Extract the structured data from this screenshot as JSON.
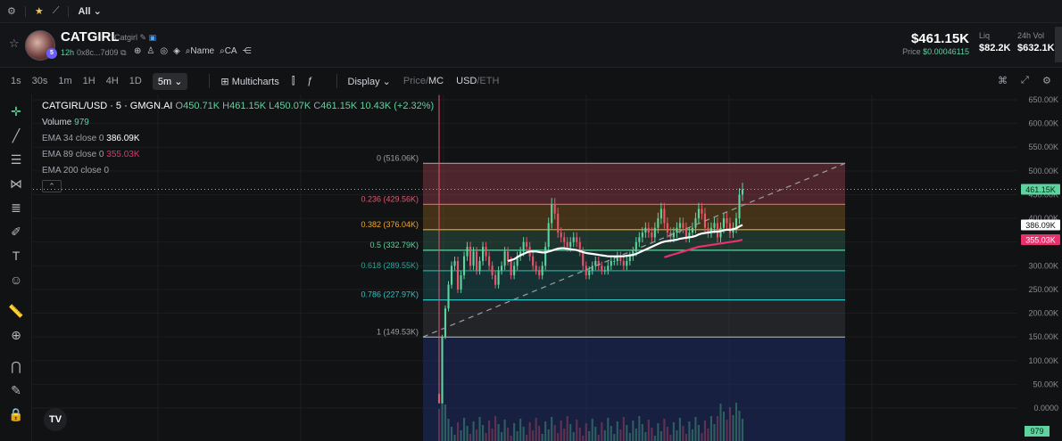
{
  "topbar": {
    "filter_label": "All"
  },
  "token": {
    "name": "CATGIRL",
    "alias": "Catgirl",
    "age": "12h",
    "address": "0x8c...7d09",
    "avatar_badge": "5",
    "links": [
      "Name",
      "CA"
    ],
    "price_usd": "$461.15K",
    "price_label": "Price",
    "price_native": "$0.00046115",
    "liq_label": "Liq",
    "liq_value": "$82.2K",
    "vol_label": "24h Vol",
    "vol_value": "$632.1K"
  },
  "toolbar": {
    "timeframes": [
      "1s",
      "30s",
      "1m",
      "1H",
      "4H",
      "1D"
    ],
    "active_timeframe": "5m",
    "multicharts": "Multicharts",
    "display": "Display",
    "price": "Price",
    "mc": "MC",
    "usd": "USD",
    "eth": "ETH"
  },
  "legend": {
    "symbol": "CATGIRL/USD · 5 · GMGN.AI",
    "o": "450.71K",
    "h": "461.15K",
    "l": "450.07K",
    "c": "461.15K",
    "chg": "10.43K (+2.32%)",
    "volume_label": "Volume",
    "volume_value": "979",
    "ema34_label": "EMA 34 close 0",
    "ema34_value": "386.09K",
    "ema89_label": "EMA 89 close 0",
    "ema89_value": "355.03K",
    "ema200_label": "EMA 200 close 0"
  },
  "colors": {
    "up": "#5dd39e",
    "down": "#e8566c",
    "ema34": "#ffffff",
    "ema89": "#e8306a",
    "bg": "#111214"
  },
  "chart_data": {
    "type": "candlestick",
    "y_axis_ticks": [
      "650.00K",
      "600.00K",
      "550.00K",
      "500.00K",
      "450.00K",
      "400.00K",
      "350.00K",
      "300.00K",
      "250.00K",
      "200.00K",
      "150.00K",
      "100.00K",
      "50.00K",
      "0.0000"
    ],
    "ylim": [
      0,
      650000
    ],
    "fib_levels": [
      {
        "ratio": "0",
        "value": "516.06K",
        "v": 516060,
        "color": "#9aa0a6"
      },
      {
        "ratio": "0.236",
        "value": "429.56K",
        "v": 429560,
        "color": "#e8566c"
      },
      {
        "ratio": "0.382",
        "value": "376.04K",
        "v": 376040,
        "color": "#f5a623"
      },
      {
        "ratio": "0.5",
        "value": "332.79K",
        "v": 332790,
        "color": "#5dd39e"
      },
      {
        "ratio": "0.618",
        "value": "289.55K",
        "v": 289550,
        "color": "#26a69a"
      },
      {
        "ratio": "0.786",
        "value": "227.97K",
        "v": 227970,
        "color": "#2ec4c4"
      },
      {
        "ratio": "1",
        "value": "149.53K",
        "v": 149530,
        "color": "#9aa0a6"
      }
    ],
    "price_tags": [
      {
        "label": "461.15K",
        "v": 461150,
        "bg": "#5dd39e",
        "fg": "#0b2a1c"
      },
      {
        "label": "386.09K",
        "v": 386090,
        "bg": "#ffffff",
        "fg": "#111"
      },
      {
        "label": "355.03K",
        "v": 355030,
        "bg": "#e8306a",
        "fg": "#fff"
      }
    ],
    "volume_tag": "979",
    "closes": [
      10000,
      150000,
      210000,
      260000,
      300000,
      310000,
      250000,
      280000,
      320000,
      340000,
      300000,
      330000,
      290000,
      310000,
      340000,
      320000,
      300000,
      280000,
      260000,
      290000,
      300000,
      330000,
      310000,
      280000,
      300000,
      320000,
      330000,
      350000,
      340000,
      320000,
      300000,
      290000,
      280000,
      300000,
      340000,
      390000,
      430000,
      410000,
      370000,
      360000,
      350000,
      340000,
      350000,
      360000,
      350000,
      330000,
      300000,
      280000,
      290000,
      300000,
      310000,
      300000,
      290000,
      290000,
      300000,
      310000,
      310000,
      320000,
      310000,
      300000,
      310000,
      320000,
      330000,
      350000,
      360000,
      370000,
      380000,
      370000,
      360000,
      380000,
      400000,
      420000,
      390000,
      370000,
      360000,
      370000,
      380000,
      390000,
      380000,
      360000,
      370000,
      380000,
      400000,
      420000,
      410000,
      380000,
      370000,
      380000,
      390000,
      360000,
      380000,
      400000,
      390000,
      370000,
      380000,
      400000,
      450000,
      461150
    ],
    "ema34": [
      null,
      null,
      null,
      null,
      null,
      null,
      null,
      null,
      null,
      null,
      null,
      null,
      null,
      null,
      null,
      null,
      null,
      null,
      null,
      null,
      null,
      null,
      310000,
      312000,
      314000,
      318000,
      322000,
      325000,
      328000,
      330000,
      330000,
      330000,
      329000,
      328000,
      328000,
      330000,
      332000,
      334000,
      336000,
      337000,
      337000,
      336000,
      335000,
      334000,
      333000,
      331000,
      329000,
      327000,
      326000,
      325000,
      324000,
      323000,
      322000,
      321000,
      320000,
      320000,
      320000,
      320000,
      320000,
      320000,
      321000,
      322000,
      323000,
      325000,
      328000,
      331000,
      334000,
      337000,
      340000,
      343000,
      346000,
      349000,
      351000,
      352000,
      353000,
      354000,
      355000,
      357000,
      358000,
      359000,
      360000,
      361000,
      363000,
      366000,
      368000,
      369000,
      370000,
      371000,
      372000,
      372000,
      373000,
      375000,
      376000,
      376000,
      377000,
      379000,
      383000,
      386090
    ],
    "ema89": [
      null,
      null,
      null,
      null,
      null,
      null,
      null,
      null,
      null,
      null,
      null,
      null,
      null,
      null,
      null,
      null,
      null,
      null,
      null,
      null,
      null,
      null,
      null,
      null,
      null,
      null,
      null,
      null,
      null,
      null,
      null,
      null,
      null,
      null,
      null,
      null,
      null,
      null,
      null,
      null,
      null,
      null,
      null,
      null,
      null,
      null,
      null,
      null,
      null,
      null,
      null,
      null,
      null,
      null,
      null,
      null,
      null,
      null,
      null,
      null,
      null,
      null,
      null,
      null,
      null,
      null,
      null,
      null,
      null,
      null,
      null,
      null,
      318000,
      320000,
      322000,
      324000,
      326000,
      328000,
      330000,
      332000,
      334000,
      336000,
      338000,
      340000,
      341000,
      342000,
      343000,
      344000,
      345000,
      346000,
      347000,
      348000,
      349000,
      350000,
      351000,
      352000,
      353000,
      355030
    ]
  }
}
